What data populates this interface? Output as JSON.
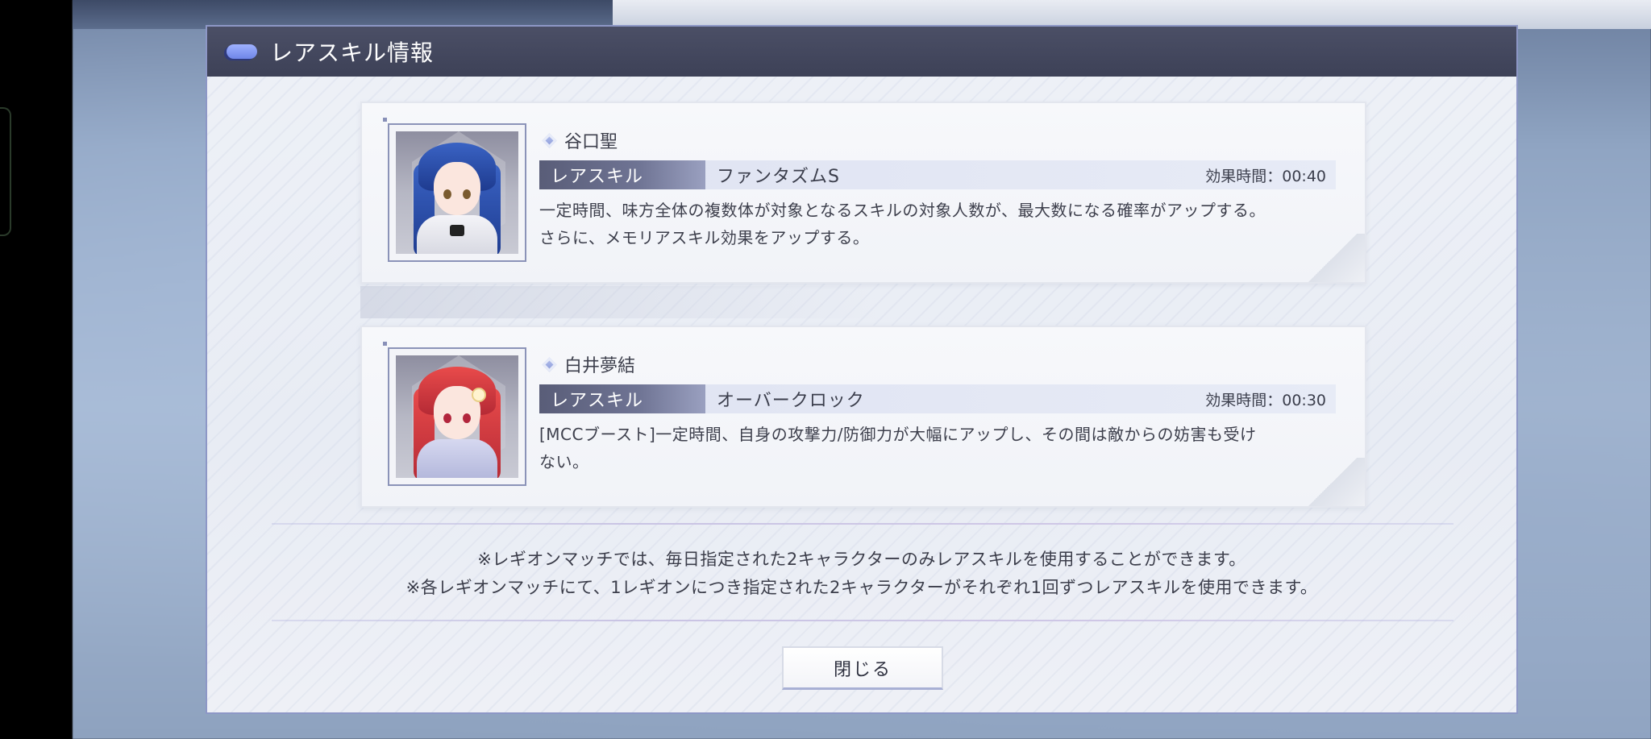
{
  "dialog": {
    "title": "レアスキル情報",
    "close_label": "閉じる"
  },
  "skills": [
    {
      "character_name": "谷口聖",
      "tag_label": "レアスキル",
      "skill_name": "ファンタズムS",
      "effect_time": "効果時間：00:40",
      "description_line1": "一定時間、味方全体の複数体が対象となるスキルの対象人数が、最大数になる確率がアップする。",
      "description_line2": "さらに、メモリアスキル効果をアップする。"
    },
    {
      "character_name": "白井夢結",
      "tag_label": "レアスキル",
      "skill_name": "オーバークロック",
      "effect_time": "効果時間：00:30",
      "description_line1": "[MCCブースト]一定時間、自身の攻撃力/防御力が大幅にアップし、その間は敵からの妨害も受け",
      "description_line2": "ない。"
    }
  ],
  "notes": {
    "line1": "※レギオンマッチでは、毎日指定された2キャラクターのみレアスキルを使用することができます。",
    "line2": "※各レギオンマッチにて、1レギオンにつき指定された2キャラクターがそれぞれ1回ずつレアスキルを使用できます。"
  },
  "colors": {
    "header_bg": "#3d4157",
    "tag_bg": "#595d78",
    "accent": "#8d97c6"
  }
}
